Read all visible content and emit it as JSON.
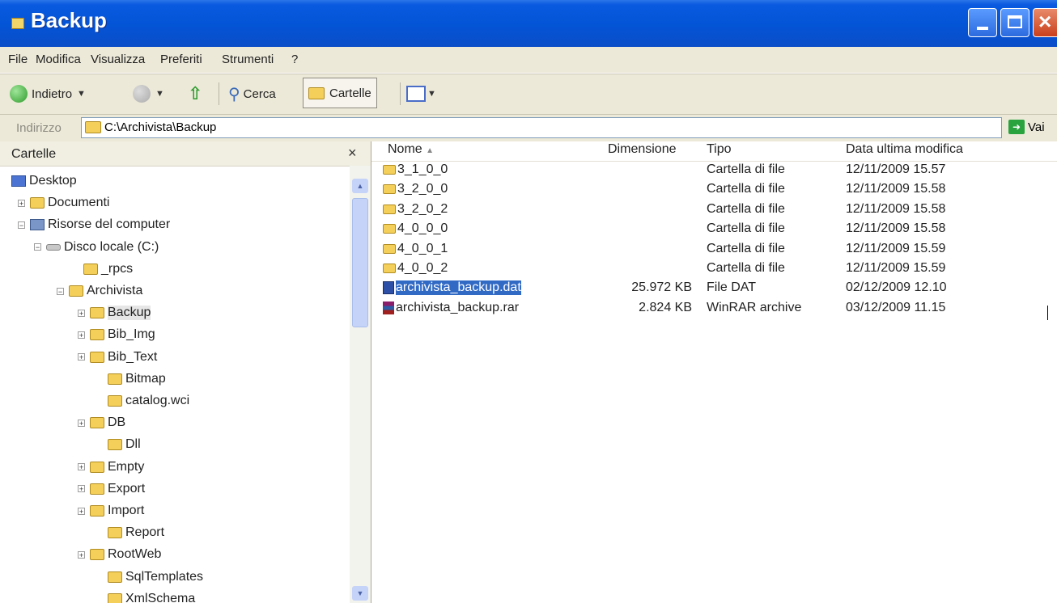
{
  "window": {
    "title": "Backup"
  },
  "menu": {
    "items": [
      "File",
      "Modifica",
      "Visualizza",
      "Preferiti",
      "Strumenti",
      "?"
    ]
  },
  "toolbar": {
    "back": "Indietro",
    "search": "Cerca",
    "folders": "Cartelle"
  },
  "address": {
    "label": "Indirizzo",
    "path": "C:\\Archivista\\Backup",
    "go": "Vai"
  },
  "tree": {
    "title": "Cartelle",
    "close": "×",
    "nodes": [
      {
        "label": "Desktop",
        "icon": "desktop-icon"
      },
      {
        "label": "Documenti",
        "icon": "folder-icon",
        "expand": "+"
      },
      {
        "label": "Risorse del computer",
        "icon": "computer-icon",
        "expand": "−"
      },
      {
        "label": "Disco locale (C:)",
        "icon": "disk-icon",
        "expand": "−"
      },
      {
        "label": "_rpcs",
        "icon": "folder-icon"
      },
      {
        "label": "Archivista",
        "icon": "folder-icon",
        "expand": "−"
      },
      {
        "label": "Backup",
        "icon": "folder-icon",
        "expand": "+"
      },
      {
        "label": "Bib_Img",
        "icon": "folder-icon",
        "expand": "+"
      },
      {
        "label": "Bib_Text",
        "icon": "folder-icon",
        "expand": "+"
      },
      {
        "label": "Bitmap",
        "icon": "folder-icon"
      },
      {
        "label": "catalog.wci",
        "icon": "folder-icon"
      },
      {
        "label": "DB",
        "icon": "folder-icon",
        "expand": "+"
      },
      {
        "label": "Dll",
        "icon": "folder-icon"
      },
      {
        "label": "Empty",
        "icon": "folder-icon",
        "expand": "+"
      },
      {
        "label": "Export",
        "icon": "folder-icon",
        "expand": "+"
      },
      {
        "label": "Import",
        "icon": "folder-icon",
        "expand": "+"
      },
      {
        "label": "Report",
        "icon": "folder-icon"
      },
      {
        "label": "RootWeb",
        "icon": "folder-icon",
        "expand": "+"
      },
      {
        "label": "SqlTemplates",
        "icon": "folder-icon"
      },
      {
        "label": "XmlSchema",
        "icon": "folder-icon"
      }
    ]
  },
  "files": {
    "columns": {
      "name": "Nome",
      "size": "Dimensione",
      "type": "Tipo",
      "modified": "Data ultima modifica"
    },
    "rows": [
      {
        "name": "3_1_0_0",
        "size": "",
        "type": "Cartella di file",
        "modified": "12/11/2009 15.57",
        "icon": "folder-icon"
      },
      {
        "name": "3_2_0_0",
        "size": "",
        "type": "Cartella di file",
        "modified": "12/11/2009 15.58",
        "icon": "folder-icon"
      },
      {
        "name": "3_2_0_2",
        "size": "",
        "type": "Cartella di file",
        "modified": "12/11/2009 15.58",
        "icon": "folder-icon"
      },
      {
        "name": "4_0_0_0",
        "size": "",
        "type": "Cartella di file",
        "modified": "12/11/2009 15.58",
        "icon": "folder-icon"
      },
      {
        "name": "4_0_0_1",
        "size": "",
        "type": "Cartella di file",
        "modified": "12/11/2009 15.59",
        "icon": "folder-icon"
      },
      {
        "name": "4_0_0_2",
        "size": "",
        "type": "Cartella di file",
        "modified": "12/11/2009 15.59",
        "icon": "folder-icon"
      },
      {
        "name": "archivista_backup.dat",
        "size": "25.972 KB",
        "type": "File DAT",
        "modified": "02/12/2009 12.10",
        "icon": "dat-file-icon",
        "selected": true
      },
      {
        "name": "archivista_backup.rar",
        "size": "2.824 KB",
        "type": "WinRAR archive",
        "modified": "03/12/2009 11.15",
        "icon": "rar-archive-icon"
      }
    ]
  }
}
